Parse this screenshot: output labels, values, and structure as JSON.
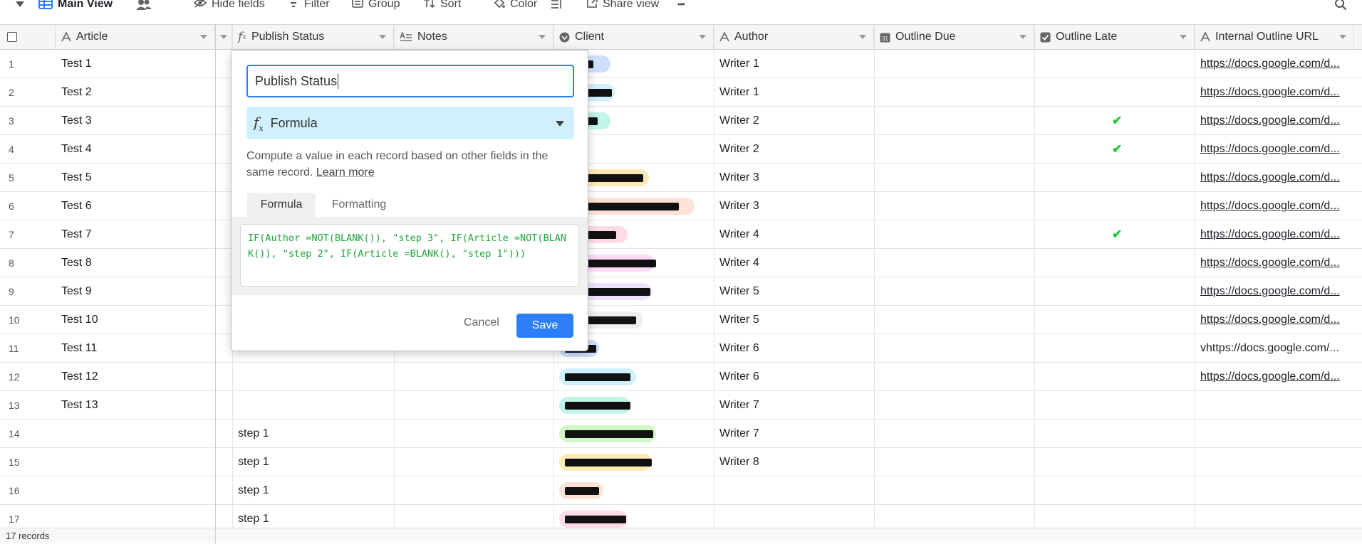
{
  "toolbar": {
    "view_name": "Main View",
    "hide_fields": "Hide fields",
    "filter": "Filter",
    "group": "Group",
    "sort": "Sort",
    "color": "Color",
    "share_view": "Share view",
    "more": "•••"
  },
  "columns": [
    {
      "name": "Article",
      "icon": "text-icon"
    },
    {
      "name": "Publish Status",
      "icon": "formula-icon"
    },
    {
      "name": "Notes",
      "icon": "long-text-icon"
    },
    {
      "name": "Client",
      "icon": "single-select-icon"
    },
    {
      "name": "Author",
      "icon": "text-icon"
    },
    {
      "name": "Outline Due",
      "icon": "calendar-icon"
    },
    {
      "name": "Outline Late",
      "icon": "checkbox-icon"
    },
    {
      "name": "Internal Outline URL",
      "icon": "text-icon"
    }
  ],
  "rows": [
    {
      "num": "1",
      "article": "Test 1",
      "status": "",
      "author": "Writer 1",
      "late": false,
      "url": "https://docs.google.com/d...",
      "client_color": "#cfdfff"
    },
    {
      "num": "2",
      "article": "Test 2",
      "status": "",
      "author": "Writer 1",
      "late": false,
      "url": "https://docs.google.com/d...",
      "client_color": "#d0f0fd"
    },
    {
      "num": "3",
      "article": "Test 3",
      "status": "",
      "author": "Writer 2",
      "late": true,
      "url": "https://docs.google.com/d...",
      "client_color": "#c2f5e9"
    },
    {
      "num": "4",
      "article": "Test 4",
      "status": "",
      "author": "Writer 2",
      "late": true,
      "url": "https://docs.google.com/d...",
      "client_color": ""
    },
    {
      "num": "5",
      "article": "Test 5",
      "status": "",
      "author": "Writer 3",
      "late": false,
      "url": "https://docs.google.com/d...",
      "client_color": "#ffeab6"
    },
    {
      "num": "6",
      "article": "Test 6",
      "status": "",
      "author": "Writer 3",
      "late": false,
      "url": "https://docs.google.com/d...",
      "client_color": "#fee2d5"
    },
    {
      "num": "7",
      "article": "Test 7",
      "status": "",
      "author": "Writer 4",
      "late": true,
      "url": "https://docs.google.com/d...",
      "client_color": "#ffdce5"
    },
    {
      "num": "8",
      "article": "Test 8",
      "status": "",
      "author": "Writer 4",
      "late": false,
      "url": "https://docs.google.com/d...",
      "client_color": "#ffdaf6"
    },
    {
      "num": "9",
      "article": "Test 9",
      "status": "",
      "author": "Writer 5",
      "late": false,
      "url": "https://docs.google.com/d...",
      "client_color": "#ede2fe"
    },
    {
      "num": "10",
      "article": "Test 10",
      "status": "",
      "author": "Writer 5",
      "late": false,
      "url": "https://docs.google.com/d...",
      "client_color": "#eeeeee"
    },
    {
      "num": "11",
      "article": "Test 11",
      "status": "",
      "author": "Writer 6",
      "late": false,
      "url": "vhttps://docs.google.com/...",
      "client_color": "#cfdfff"
    },
    {
      "num": "12",
      "article": "Test 12",
      "status": "",
      "author": "Writer 6",
      "late": false,
      "url": "https://docs.google.com/d...",
      "client_color": "#d0f0fd"
    },
    {
      "num": "13",
      "article": "Test 13",
      "status": "",
      "author": "Writer 7",
      "late": false,
      "url": "",
      "client_color": "#c2f5e9"
    },
    {
      "num": "14",
      "article": "",
      "status": "step 1",
      "author": "Writer 7",
      "late": false,
      "url": "",
      "client_color": "#d1f7c4"
    },
    {
      "num": "15",
      "article": "",
      "status": "step 1",
      "author": "Writer 8",
      "late": false,
      "url": "",
      "client_color": "#ffeab6"
    },
    {
      "num": "16",
      "article": "",
      "status": "step 1",
      "author": "",
      "late": false,
      "url": "",
      "client_color": "#fee2d5"
    },
    {
      "num": "17",
      "article": "",
      "status": "step 1",
      "author": "",
      "late": false,
      "url": "",
      "client_color": "#ffdce5"
    }
  ],
  "footer": {
    "records": "17 records"
  },
  "dialog": {
    "field_name": "Publish Status",
    "field_type": "Formula",
    "description": "Compute a value in each record based on other fields in the same record.",
    "learn_more": "Learn more",
    "tabs": [
      "Formula",
      "Formatting"
    ],
    "formula": "IF(Author =NOT(BLANK()), \"step 3\", IF(Article =NOT(BLANK()), \"step 2\", IF(Article =BLANK(), \"step 1\")))",
    "cancel": "Cancel",
    "save": "Save"
  },
  "colors": {
    "accent": "#2d7ff9",
    "type_bg": "#d0f0fd",
    "check": "#20c933",
    "formula_text": "#20a33b"
  }
}
